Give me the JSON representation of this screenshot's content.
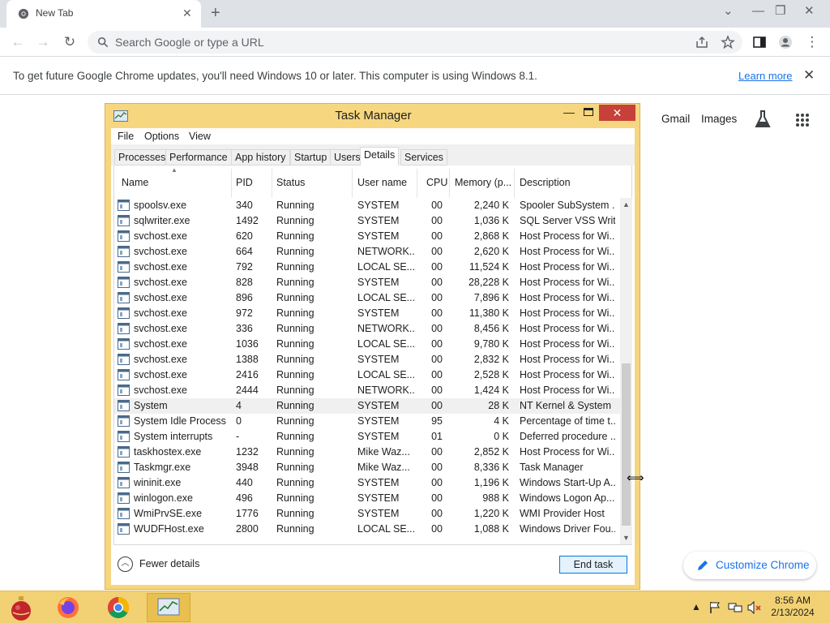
{
  "browser": {
    "tab_title": "New Tab",
    "omnibox_placeholder": "Search Google or type a URL",
    "infobar_text": "To get future Google Chrome updates, you'll need Windows 10 or later. This computer is using Windows 8.1.",
    "infobar_link": "Learn more",
    "ntp": {
      "gmail": "Gmail",
      "images": "Images",
      "customize": "Customize Chrome"
    },
    "accent_color": "#1a73e8"
  },
  "taskmgr": {
    "title": "Task Manager",
    "menu": [
      "File",
      "Options",
      "View"
    ],
    "tabs": [
      "Processes",
      "Performance",
      "App history",
      "Startup",
      "Users",
      "Details",
      "Services"
    ],
    "active_tab": "Details",
    "columns": [
      "Name",
      "PID",
      "Status",
      "User name",
      "CPU",
      "Memory (p...",
      "Description"
    ],
    "selected_row": "System",
    "rows": [
      {
        "name": "spoolsv.exe",
        "pid": "340",
        "status": "Running",
        "user": "SYSTEM",
        "cpu": "00",
        "mem": "2,240 K",
        "desc": "Spooler SubSystem ..."
      },
      {
        "name": "sqlwriter.exe",
        "pid": "1492",
        "status": "Running",
        "user": "SYSTEM",
        "cpu": "00",
        "mem": "1,036 K",
        "desc": "SQL Server VSS Writ..."
      },
      {
        "name": "svchost.exe",
        "pid": "620",
        "status": "Running",
        "user": "SYSTEM",
        "cpu": "00",
        "mem": "2,868 K",
        "desc": "Host Process for Wi..."
      },
      {
        "name": "svchost.exe",
        "pid": "664",
        "status": "Running",
        "user": "NETWORK...",
        "cpu": "00",
        "mem": "2,620 K",
        "desc": "Host Process for Wi..."
      },
      {
        "name": "svchost.exe",
        "pid": "792",
        "status": "Running",
        "user": "LOCAL SE...",
        "cpu": "00",
        "mem": "11,524 K",
        "desc": "Host Process for Wi..."
      },
      {
        "name": "svchost.exe",
        "pid": "828",
        "status": "Running",
        "user": "SYSTEM",
        "cpu": "00",
        "mem": "28,228 K",
        "desc": "Host Process for Wi..."
      },
      {
        "name": "svchost.exe",
        "pid": "896",
        "status": "Running",
        "user": "LOCAL SE...",
        "cpu": "00",
        "mem": "7,896 K",
        "desc": "Host Process for Wi..."
      },
      {
        "name": "svchost.exe",
        "pid": "972",
        "status": "Running",
        "user": "SYSTEM",
        "cpu": "00",
        "mem": "11,380 K",
        "desc": "Host Process for Wi..."
      },
      {
        "name": "svchost.exe",
        "pid": "336",
        "status": "Running",
        "user": "NETWORK...",
        "cpu": "00",
        "mem": "8,456 K",
        "desc": "Host Process for Wi..."
      },
      {
        "name": "svchost.exe",
        "pid": "1036",
        "status": "Running",
        "user": "LOCAL SE...",
        "cpu": "00",
        "mem": "9,780 K",
        "desc": "Host Process for Wi..."
      },
      {
        "name": "svchost.exe",
        "pid": "1388",
        "status": "Running",
        "user": "SYSTEM",
        "cpu": "00",
        "mem": "2,832 K",
        "desc": "Host Process for Wi..."
      },
      {
        "name": "svchost.exe",
        "pid": "2416",
        "status": "Running",
        "user": "LOCAL SE...",
        "cpu": "00",
        "mem": "2,528 K",
        "desc": "Host Process for Wi..."
      },
      {
        "name": "svchost.exe",
        "pid": "2444",
        "status": "Running",
        "user": "NETWORK...",
        "cpu": "00",
        "mem": "1,424 K",
        "desc": "Host Process for Wi..."
      },
      {
        "name": "System",
        "pid": "4",
        "status": "Running",
        "user": "SYSTEM",
        "cpu": "00",
        "mem": "28 K",
        "desc": "NT Kernel & System"
      },
      {
        "name": "System Idle Process",
        "pid": "0",
        "status": "Running",
        "user": "SYSTEM",
        "cpu": "95",
        "mem": "4 K",
        "desc": "Percentage of time t..."
      },
      {
        "name": "System interrupts",
        "pid": "-",
        "status": "Running",
        "user": "SYSTEM",
        "cpu": "01",
        "mem": "0 K",
        "desc": "Deferred procedure ..."
      },
      {
        "name": "taskhostex.exe",
        "pid": "1232",
        "status": "Running",
        "user": "Mike Waz...",
        "cpu": "00",
        "mem": "2,852 K",
        "desc": "Host Process for Wi..."
      },
      {
        "name": "Taskmgr.exe",
        "pid": "3948",
        "status": "Running",
        "user": "Mike Waz...",
        "cpu": "00",
        "mem": "8,336 K",
        "desc": "Task Manager"
      },
      {
        "name": "wininit.exe",
        "pid": "440",
        "status": "Running",
        "user": "SYSTEM",
        "cpu": "00",
        "mem": "1,196 K",
        "desc": "Windows Start-Up A..."
      },
      {
        "name": "winlogon.exe",
        "pid": "496",
        "status": "Running",
        "user": "SYSTEM",
        "cpu": "00",
        "mem": "988 K",
        "desc": "Windows Logon Ap..."
      },
      {
        "name": "WmiPrvSE.exe",
        "pid": "1776",
        "status": "Running",
        "user": "SYSTEM",
        "cpu": "00",
        "mem": "1,220 K",
        "desc": "WMI Provider Host"
      },
      {
        "name": "WUDFHost.exe",
        "pid": "2800",
        "status": "Running",
        "user": "LOCAL SE...",
        "cpu": "00",
        "mem": "1,088 K",
        "desc": "Windows Driver Fou..."
      }
    ],
    "fewer_details": "Fewer details",
    "end_task": "End task",
    "close_color": "#c7403a",
    "frame_color": "#f6d67f"
  },
  "taskbar": {
    "apps": [
      "Ornament",
      "Firefox",
      "Chrome",
      "Task Manager"
    ],
    "active_app": "Task Manager",
    "time": "8:56 AM",
    "date": "2/13/2024",
    "color": "#f2d174"
  }
}
